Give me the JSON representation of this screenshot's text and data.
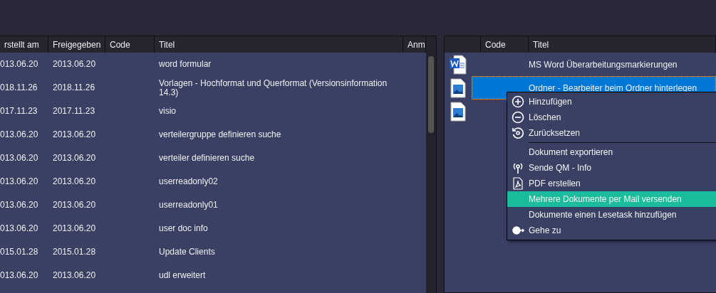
{
  "left_table": {
    "columns": [
      "rstellt am",
      "Freigegeben",
      "Code",
      "Titel",
      "Anm"
    ],
    "rows": [
      {
        "created": "013.06.20",
        "released": "2013.06.20",
        "title": "word formular"
      },
      {
        "created": "018.11.26",
        "released": "2018.11.26",
        "title": "Vorlagen - Hochformat und Querformat (Versionsinformation 14.3)"
      },
      {
        "created": "017.11.23",
        "released": "2017.11.23",
        "title": "visio"
      },
      {
        "created": "013.06.20",
        "released": "2013.06.20",
        "title": "verteilergruppe definieren suche"
      },
      {
        "created": "013.06.20",
        "released": "2013.06.20",
        "title": "verteiler definieren suche"
      },
      {
        "created": "013.06.20",
        "released": "2013.06.20",
        "title": "userreadonly02"
      },
      {
        "created": "013.06.20",
        "released": "2013.06.20",
        "title": "userreadonly01"
      },
      {
        "created": "013.06.20",
        "released": "2013.06.20",
        "title": "user doc info"
      },
      {
        "created": "015.01.28",
        "released": "2015.01.28",
        "title": "Update Clients"
      },
      {
        "created": "013.06.20",
        "released": "2013.06.20",
        "title": "udl erweitert"
      }
    ]
  },
  "right_table": {
    "columns": [
      "Code",
      "Titel"
    ],
    "rows": [
      {
        "kind": "word",
        "title": "MS Word Überarbeitungsmarkierungen",
        "selected": false
      },
      {
        "kind": "image",
        "title": "Ordner - Bearbeiter beim Ordner hinterlegen",
        "selected": true
      },
      {
        "kind": "image",
        "selected": false
      }
    ]
  },
  "context_menu": [
    {
      "kind": "add",
      "label": "Hinzufügen",
      "highlighted": false
    },
    {
      "kind": "remove",
      "label": "Löschen",
      "highlighted": false
    },
    {
      "kind": "reset",
      "label": "Zurücksetzen",
      "highlighted": false
    },
    {
      "kind": "separator"
    },
    {
      "kind": "plain",
      "label": "Dokument exportieren",
      "highlighted": false
    },
    {
      "kind": "send",
      "label": "Sende QM - Info",
      "highlighted": false
    },
    {
      "kind": "pdf",
      "label": "PDF erstellen",
      "highlighted": false
    },
    {
      "kind": "plain",
      "label": "Mehrere Dokumente per Mail versenden",
      "highlighted": true
    },
    {
      "kind": "plain",
      "label": "Dokumente einen Lesetask hinzufügen",
      "highlighted": false
    },
    {
      "kind": "goto",
      "label": "Gehe zu",
      "highlighted": false
    }
  ]
}
